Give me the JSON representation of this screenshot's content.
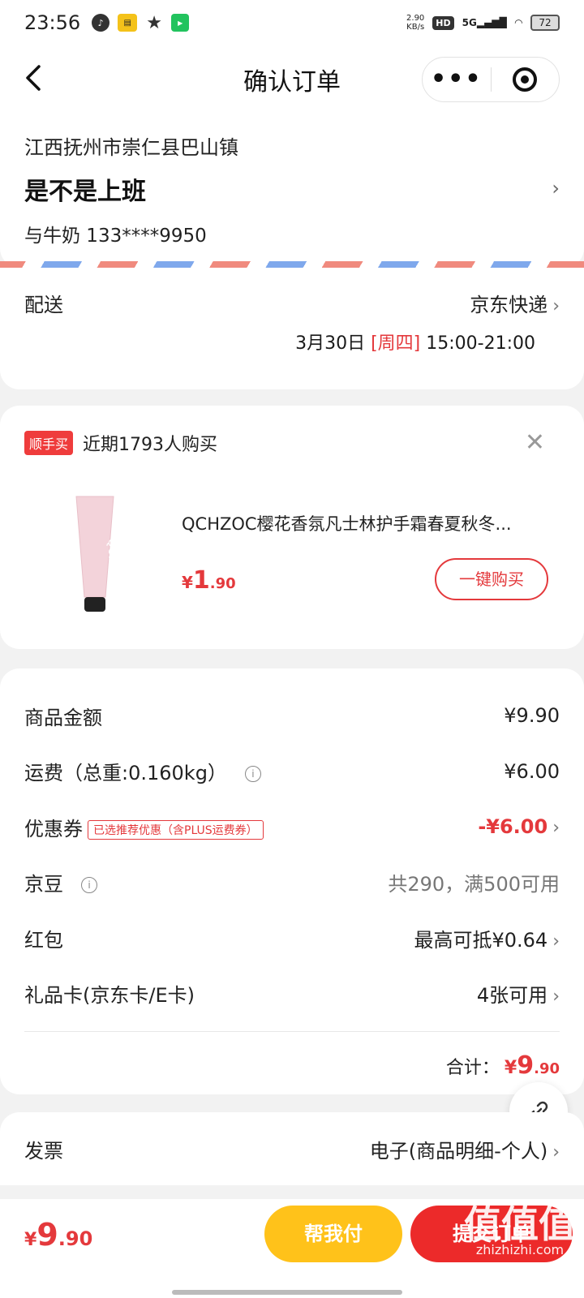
{
  "status_bar": {
    "time": "23:56",
    "speed_top": "2.90",
    "speed_unit": "KB/s",
    "hd": "HD",
    "network": "5G",
    "battery": "72",
    "left_icons": [
      "music-app-icon",
      "app-square-icon",
      "star-icon",
      "iqiyi-icon"
    ]
  },
  "nav": {
    "title": "确认订单",
    "back_icon": "chevron-left-icon",
    "more_label": "•••",
    "close_icon": "target-icon"
  },
  "address": {
    "region": "江西抚州市崇仁县巴山镇",
    "detail": "是不是上班",
    "contact": "与牛奶 133****9950"
  },
  "delivery": {
    "label": "配送",
    "carrier": "京东快递",
    "date": "3月30日 ",
    "weekday": "[周四]",
    "time_window": " 15:00-21:00"
  },
  "recommend": {
    "tag": "顺手买",
    "title": "近期1793人购买",
    "product_name": "QCHZOC樱花香氛凡士林护手霜春夏秋冬...",
    "price_yen": "¥",
    "price_int": "1",
    "price_dec": ".90",
    "buy_label": "一键购买"
  },
  "summary": {
    "goods_label": "商品金额",
    "goods_value": "¥9.90",
    "freight_label": "运费（总重:0.160kg）",
    "freight_value": "¥6.00",
    "coupon_label": "优惠券",
    "coupon_tag": "已选推荐优惠（含PLUS运费券）",
    "coupon_value": "-¥6.00",
    "jingdou_label": "京豆",
    "jingdou_value": "共290，满500可用",
    "hongbao_label": "红包",
    "hongbao_value": "最高可抵¥0.64",
    "giftcard_label": "礼品卡(京东卡/E卡)",
    "giftcard_value": "4张可用",
    "total_label": "合计：",
    "total_yen": "¥",
    "total_int": "9",
    "total_dec": ".90"
  },
  "invoice": {
    "label": "发票",
    "value": "电子(商品明细-个人)"
  },
  "bottom": {
    "price_yen": "¥",
    "price_int": "9",
    "price_dec": ".90",
    "help_pay": "帮我付",
    "submit": "提交订单"
  },
  "watermark": {
    "text": "值值值",
    "url": "zhizhizhi.com"
  },
  "colors": {
    "accent_red": "#e4393c",
    "help_yellow": "#ffc21a",
    "submit_red": "#ec2a2a"
  }
}
